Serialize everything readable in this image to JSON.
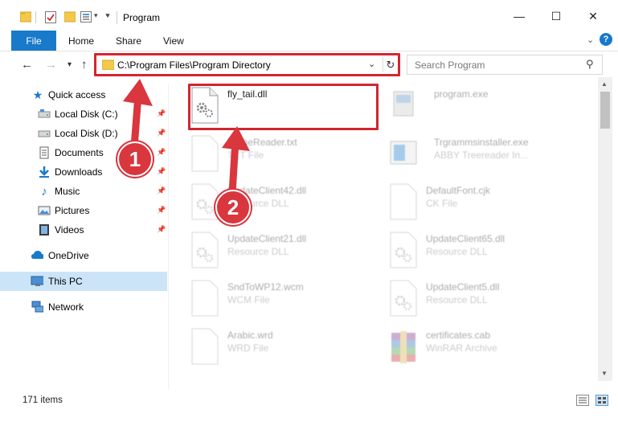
{
  "window": {
    "title": "Program",
    "minimize_glyph": "—",
    "maximize_glyph": "☐",
    "close_glyph": "✕"
  },
  "ribbon": {
    "tabs": [
      {
        "label": "File",
        "active": true
      },
      {
        "label": "Home"
      },
      {
        "label": "Share"
      },
      {
        "label": "View"
      }
    ],
    "help_glyph": "?"
  },
  "address_bar": {
    "path": "C:\\Program Files\\Program Directory",
    "search_placeholder": "Search Program"
  },
  "sidebar": {
    "items": [
      {
        "label": "Quick access",
        "icon": "star-icon",
        "pinned": false
      },
      {
        "label": "Local Disk (C:)",
        "icon": "drive-icon",
        "pinned": true
      },
      {
        "label": "Local Disk (D:)",
        "icon": "drive-icon",
        "pinned": true
      },
      {
        "label": "Documents",
        "icon": "documents-icon",
        "pinned": true
      },
      {
        "label": "Downloads",
        "icon": "download-icon",
        "pinned": true
      },
      {
        "label": "Music",
        "icon": "music-icon",
        "pinned": true
      },
      {
        "label": "Pictures",
        "icon": "pictures-icon",
        "pinned": true
      },
      {
        "label": "Videos",
        "icon": "videos-icon",
        "pinned": true
      },
      {
        "label": "OneDrive",
        "icon": "cloud-icon",
        "pinned": false
      },
      {
        "label": "This PC",
        "icon": "computer-icon",
        "pinned": false,
        "selected": true
      },
      {
        "label": "Network",
        "icon": "network-icon",
        "pinned": false
      }
    ]
  },
  "files": [
    {
      "name": "fly_tail.dll",
      "type": "",
      "icon": "dll-gear-icon",
      "highlighted": true,
      "faded": false
    },
    {
      "name": "program.exe",
      "type": "",
      "icon": "exe-icon",
      "faded": true
    },
    {
      "name": "lp fineReader.txt",
      "type": "TXT File",
      "icon": "blank-file-icon",
      "faded": true
    },
    {
      "name": "Trgrammsinstaller.exe",
      "type": "ABBY Treereader In...",
      "icon": "installer-icon",
      "faded": true
    },
    {
      "name": "UpdateClient42.dll",
      "type": "Resource DLL",
      "icon": "dll-gear-icon",
      "faded": true
    },
    {
      "name": "DefaultFont.cjk",
      "type": "CK File",
      "icon": "blank-file-icon",
      "faded": true
    },
    {
      "name": "UpdateClient21.dll",
      "type": "Resource DLL",
      "icon": "dll-gear-icon",
      "faded": true
    },
    {
      "name": "UpdateClient65.dll",
      "type": "Resource DLL",
      "icon": "dll-gear-icon",
      "faded": true
    },
    {
      "name": "SndToWP12.wcm",
      "type": "WCM File",
      "icon": "blank-file-icon",
      "faded": true
    },
    {
      "name": "UpdateClient5.dll",
      "type": "Resource DLL",
      "icon": "dll-gear-icon",
      "faded": true
    },
    {
      "name": "Arabic.wrd",
      "type": "WRD File",
      "icon": "blank-file-icon",
      "faded": true
    },
    {
      "name": "certificates.cab",
      "type": "WinRAR Archive",
      "icon": "winrar-icon",
      "faded": true
    }
  ],
  "callouts": [
    {
      "number": "1",
      "target": "address-bar"
    },
    {
      "number": "2",
      "target": "fly_tail.dll"
    }
  ],
  "status_bar": {
    "item_count": "171 items"
  },
  "colors": {
    "accent": "#1979ca",
    "highlight_red": "#d22630",
    "badge_red": "#d9363e",
    "selection": "#cce4f7",
    "folder_yellow": "#f3c94b"
  }
}
